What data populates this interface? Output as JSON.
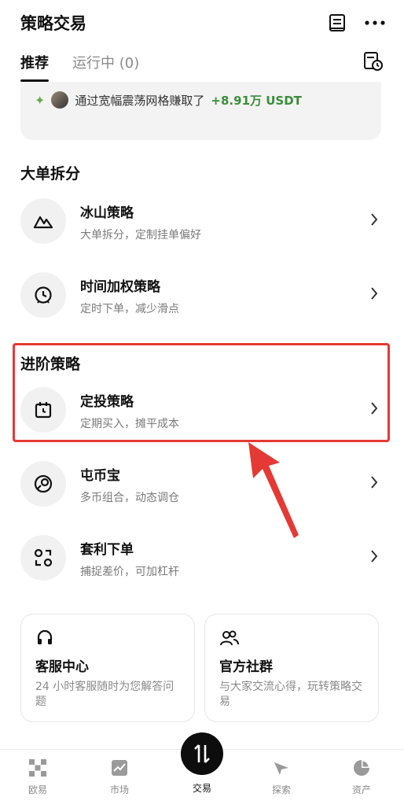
{
  "header": {
    "title": "策略交易",
    "tabs": [
      {
        "label": "推荐",
        "active": true
      },
      {
        "label": "运行中 (0)",
        "active": false
      }
    ],
    "icons": [
      "document-icon",
      "more-icon",
      "history-icon"
    ]
  },
  "promo": {
    "text": "通过宽幅震荡网格赚取了",
    "amount": "+8.91万 USDT"
  },
  "sections": {
    "large_order": {
      "heading": "大单拆分",
      "items": [
        {
          "name": "冰山策略",
          "desc": "大单拆分，定制挂单偏好",
          "icon": "mountain-icon"
        },
        {
          "name": "时间加权策略",
          "desc": "定时下单，减少滑点",
          "icon": "clock-icon"
        }
      ]
    },
    "advanced": {
      "heading": "进阶策略",
      "items": [
        {
          "name": "定投策略",
          "desc": "定期买入，摊平成本",
          "icon": "calendar-icon"
        },
        {
          "name": "屯币宝",
          "desc": "多币组合，动态调仓",
          "icon": "coin-icon"
        },
        {
          "name": "套利下单",
          "desc": "捕捉差价，可加杠杆",
          "icon": "arbitrage-icon"
        }
      ]
    }
  },
  "cards": [
    {
      "title": "客服中心",
      "desc": "24 小时客服随时为您解答问题",
      "icon": "headset-icon"
    },
    {
      "title": "官方社群",
      "desc": "与大家交流心得，玩转策略交易",
      "icon": "community-icon"
    }
  ],
  "bottom_nav": [
    {
      "label": "欧易",
      "icon": "logo-icon"
    },
    {
      "label": "市场",
      "icon": "chart-icon"
    },
    {
      "label": "交易",
      "icon": "trade-icon",
      "active": true
    },
    {
      "label": "探索",
      "icon": "compass-icon"
    },
    {
      "label": "资产",
      "icon": "pie-icon"
    }
  ],
  "colors": {
    "highlight": "#e53935",
    "profit": "#3a8e3a",
    "arrow": "#e53935"
  }
}
